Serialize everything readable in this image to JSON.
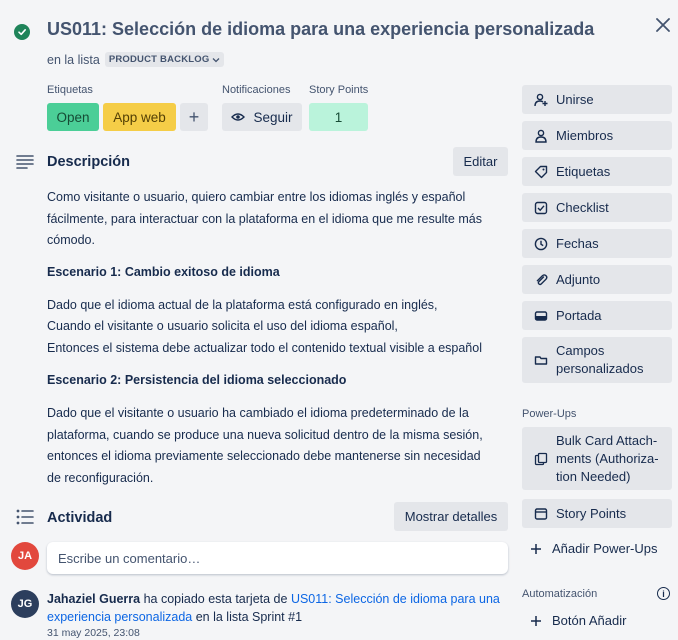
{
  "card": {
    "title": "US011: Selección de idioma para una experiencia personalizada",
    "in_list_prefix": "en la lista",
    "list_name": "PRODUCT BACKLOG"
  },
  "labels": {
    "heading": "Etiquetas",
    "items": [
      {
        "text": "Open",
        "color": "#4bce97"
      },
      {
        "text": "App web",
        "color": "#f5cd47"
      }
    ],
    "add": "+"
  },
  "notifications": {
    "heading": "Notificaciones",
    "watch_label": "Seguir"
  },
  "story_points": {
    "heading": "Story Points",
    "value": "1"
  },
  "description": {
    "heading": "Descripción",
    "edit_label": "Editar",
    "intro": "Como visitante o usuario, quiero cambiar entre los idiomas inglés y español fácilmente, para interactuar con la plataforma en el idioma que me resulte más cómodo.",
    "scenario1_title": "Escenario 1: Cambio exitoso de idioma",
    "scenario1_line1": "Dado que el idioma actual de la plataforma está configurado en inglés,",
    "scenario1_line2": "Cuando el visitante o usuario solicita el uso del idioma español,",
    "scenario1_line3": "Entonces el sistema debe actualizar todo el contenido textual visible a español",
    "scenario2_title": "Escenario 2: Persistencia del idioma seleccionado",
    "scenario2_text": "Dado que el visitante o usuario ha cambiado el idioma predeterminado de la plataforma, cuando se produce una nueva solicitud dentro de la misma sesión, entonces el idioma previamente seleccionado debe mantenerse sin necesidad de reconfiguración."
  },
  "activity": {
    "heading": "Actividad",
    "show_details": "Mostrar detalles",
    "comment_placeholder": "Escribe un comentario…",
    "current_user_initials": "JA",
    "entry": {
      "initials": "JG",
      "user": "Jahaziel Guerra",
      "action": "ha copiado esta tarjeta de",
      "link": "US011: Selección de idioma para una experiencia personalizada",
      "suffix": "en la lista Sprint #1",
      "timestamp": "31 may 2025, 23:08"
    }
  },
  "sidebar": {
    "join": "Unirse",
    "members": "Miembros",
    "labels": "Etiquetas",
    "checklist": "Checklist",
    "dates": "Fechas",
    "attachment": "Adjunto",
    "cover": "Portada",
    "custom_fields": "Campos personalizados",
    "powerups_heading": "Power-Ups",
    "bulk_attach": "Bulk Card Attach­ments (Authoriza­tion Needed)",
    "story_points": "Story Points",
    "add_powerups": "Añadir Power-Ups",
    "automation_heading": "Automatización",
    "add_button": "Botón Añadir"
  },
  "colors": {
    "accent": "#0c66e4",
    "story_points_bg": "#baf3db",
    "avatar_ja": "#e2483d",
    "avatar_jg": "#2c3e5d",
    "check": "#1f845a"
  }
}
